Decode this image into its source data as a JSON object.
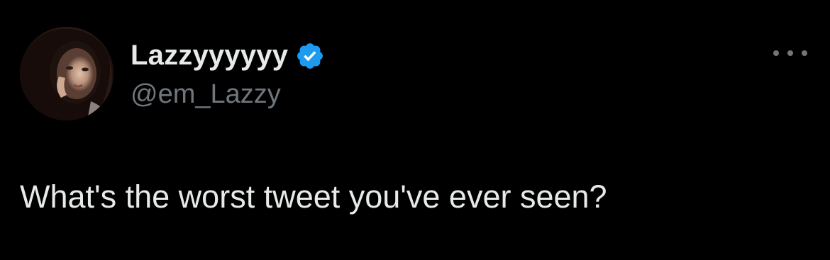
{
  "tweet": {
    "author": {
      "display_name": "Lazzyyyyyy",
      "handle": "@em_Lazzy",
      "verified": true,
      "verified_icon": "verified-badge-icon",
      "avatar": "profile-photo"
    },
    "menu_icon": "more-options-icon",
    "text": "What's the worst tweet you've ever seen?"
  },
  "colors": {
    "background": "#000000",
    "primary_text": "#e7e9ea",
    "secondary_text": "#71767b",
    "verified_blue": "#1d9bf0"
  }
}
